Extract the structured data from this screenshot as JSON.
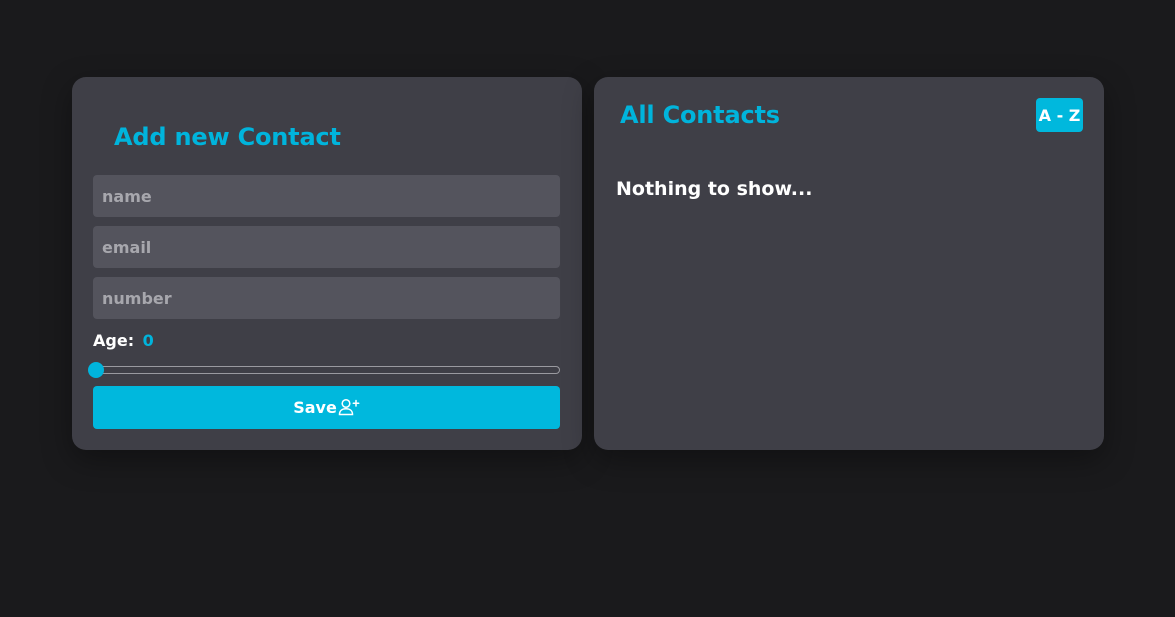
{
  "form": {
    "title": "Add new Contact",
    "name_placeholder": "name",
    "email_placeholder": "email",
    "number_placeholder": "number",
    "age_label": "Age:",
    "age_value": "0",
    "age_slider_fraction": 0,
    "save_label": "Save",
    "save_icon": "user-plus-icon"
  },
  "contacts": {
    "title": "All Contacts",
    "sort_label": "A - Z",
    "empty_message": "Nothing to show..."
  },
  "colors": {
    "background": "#1a1a1c",
    "card": "#3f3f47",
    "input": "#54545d",
    "accent": "#00b4dc",
    "text": "#ffffff"
  }
}
